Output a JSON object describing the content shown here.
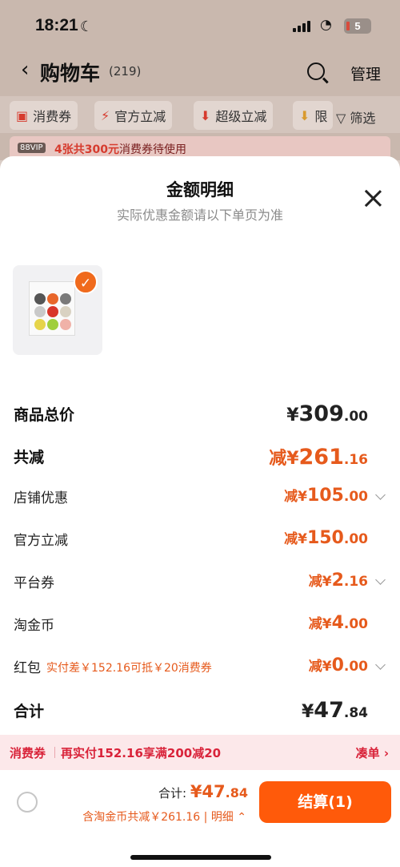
{
  "status_bar": {
    "time": "18:21",
    "battery": "5"
  },
  "nav": {
    "title": "购物车",
    "count": "(219)",
    "manage": "管理"
  },
  "filters": [
    "消费券",
    "官方立减",
    "超级立减",
    "限"
  ],
  "filter_btn": "筛选",
  "vip": {
    "tag": "88VIP",
    "highlight": "4张共300元",
    "text": "消费券待使用"
  },
  "sheet": {
    "title": "金额明细",
    "subtitle": "实际优惠金额请以下单页为准",
    "rows": [
      {
        "label": "商品总价",
        "prefix": "¥",
        "int": "309",
        "dec": ".00"
      },
      {
        "label": "共减",
        "prefix": "减¥",
        "int": "261",
        "dec": ".16"
      },
      {
        "label": "店铺优惠",
        "prefix": "减¥",
        "int": "105",
        "dec": ".00"
      },
      {
        "label": "官方立减",
        "prefix": "减¥",
        "int": "150",
        "dec": ".00"
      },
      {
        "label": "平台券",
        "prefix": "减¥",
        "int": "2",
        "dec": ".16"
      },
      {
        "label": "淘金币",
        "prefix": "减¥",
        "int": "4",
        "dec": ".00"
      },
      {
        "label": "红包",
        "note": "实付差￥152.16可抵￥20消费券",
        "prefix": "减¥",
        "int": "0",
        "dec": ".00"
      },
      {
        "label": "合计",
        "prefix": "¥",
        "int": "47",
        "dec": ".84"
      }
    ]
  },
  "coupon": {
    "label": "消费券",
    "text": "再实付152.16享满200减20",
    "link": "凑单 ›"
  },
  "bottom": {
    "total_label": "合计: ",
    "total_int": "¥47",
    "total_dec": ".84",
    "sub_text": "含淘金币共减￥261.16 | ",
    "detail": "明细 ⌃",
    "checkout": "结算(1)"
  }
}
